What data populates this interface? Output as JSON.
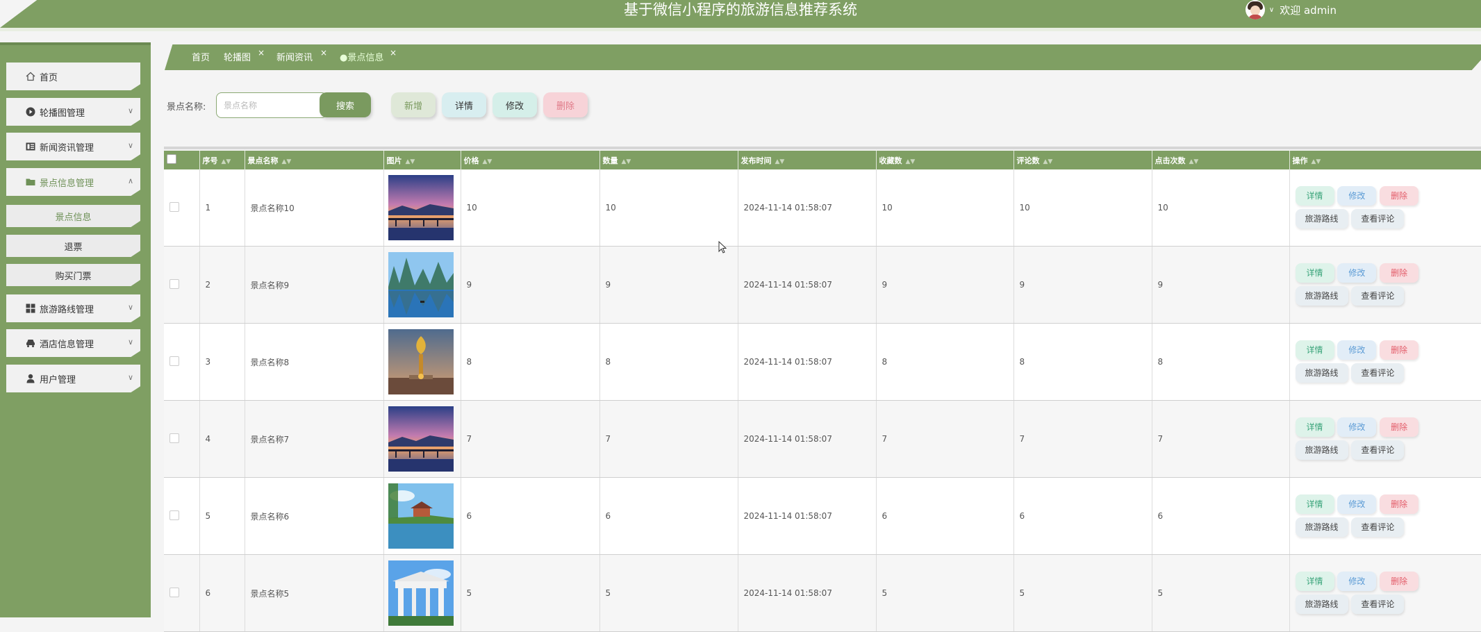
{
  "header": {
    "title": "基于微信小程序的旅游信息推荐系统",
    "welcome": "欢迎 admin"
  },
  "sidebar": {
    "items": [
      {
        "label": "首页",
        "icon": "home-icon"
      },
      {
        "label": "轮播图管理",
        "icon": "carousel-icon"
      },
      {
        "label": "新闻资讯管理",
        "icon": "news-icon"
      },
      {
        "label": "景点信息管理",
        "icon": "folder-icon"
      },
      {
        "label": "旅游路线管理",
        "icon": "grid-icon"
      },
      {
        "label": "酒店信息管理",
        "icon": "hotel-icon"
      },
      {
        "label": "用户管理",
        "icon": "user-icon"
      }
    ],
    "sub_items": [
      "景点信息",
      "退票",
      "购买门票"
    ]
  },
  "tabs": [
    {
      "label": "首页"
    },
    {
      "label": "轮播图"
    },
    {
      "label": "新闻资讯"
    },
    {
      "label": "景点信息"
    }
  ],
  "search": {
    "label": "景点名称:",
    "placeholder": "景点名称",
    "button": "搜索"
  },
  "actions": {
    "add": "新增",
    "detail": "详情",
    "edit": "修改",
    "delete": "删除"
  },
  "table": {
    "columns": [
      "序号",
      "景点名称",
      "图片",
      "价格",
      "数量",
      "发布时间",
      "收藏数",
      "评论数",
      "点击次数",
      "操作"
    ],
    "op_labels": {
      "detail": "详情",
      "edit": "修改",
      "delete": "删除",
      "route": "旅游路线",
      "comment": "查看评论"
    },
    "rows": [
      {
        "no": "1",
        "name": "景点名称10",
        "price": "10",
        "qty": "10",
        "time": "2024-11-14 01:58:07",
        "fav": "10",
        "comments": "10",
        "clicks": "10"
      },
      {
        "no": "2",
        "name": "景点名称9",
        "price": "9",
        "qty": "9",
        "time": "2024-11-14 01:58:07",
        "fav": "9",
        "comments": "9",
        "clicks": "9"
      },
      {
        "no": "3",
        "name": "景点名称8",
        "price": "8",
        "qty": "8",
        "time": "2024-11-14 01:58:07",
        "fav": "8",
        "comments": "8",
        "clicks": "8"
      },
      {
        "no": "4",
        "name": "景点名称7",
        "price": "7",
        "qty": "7",
        "time": "2024-11-14 01:58:07",
        "fav": "7",
        "comments": "7",
        "clicks": "7"
      },
      {
        "no": "5",
        "name": "景点名称6",
        "price": "6",
        "qty": "6",
        "time": "2024-11-14 01:58:07",
        "fav": "6",
        "comments": "6",
        "clicks": "6"
      },
      {
        "no": "6",
        "name": "景点名称5",
        "price": "5",
        "qty": "5",
        "time": "2024-11-14 01:58:07",
        "fav": "5",
        "comments": "5",
        "clicks": "5"
      }
    ]
  },
  "colors": {
    "primary": "#7f9f63",
    "detail": "#3aa47a",
    "edit": "#5b9bd5",
    "delete": "#e35d6a"
  }
}
